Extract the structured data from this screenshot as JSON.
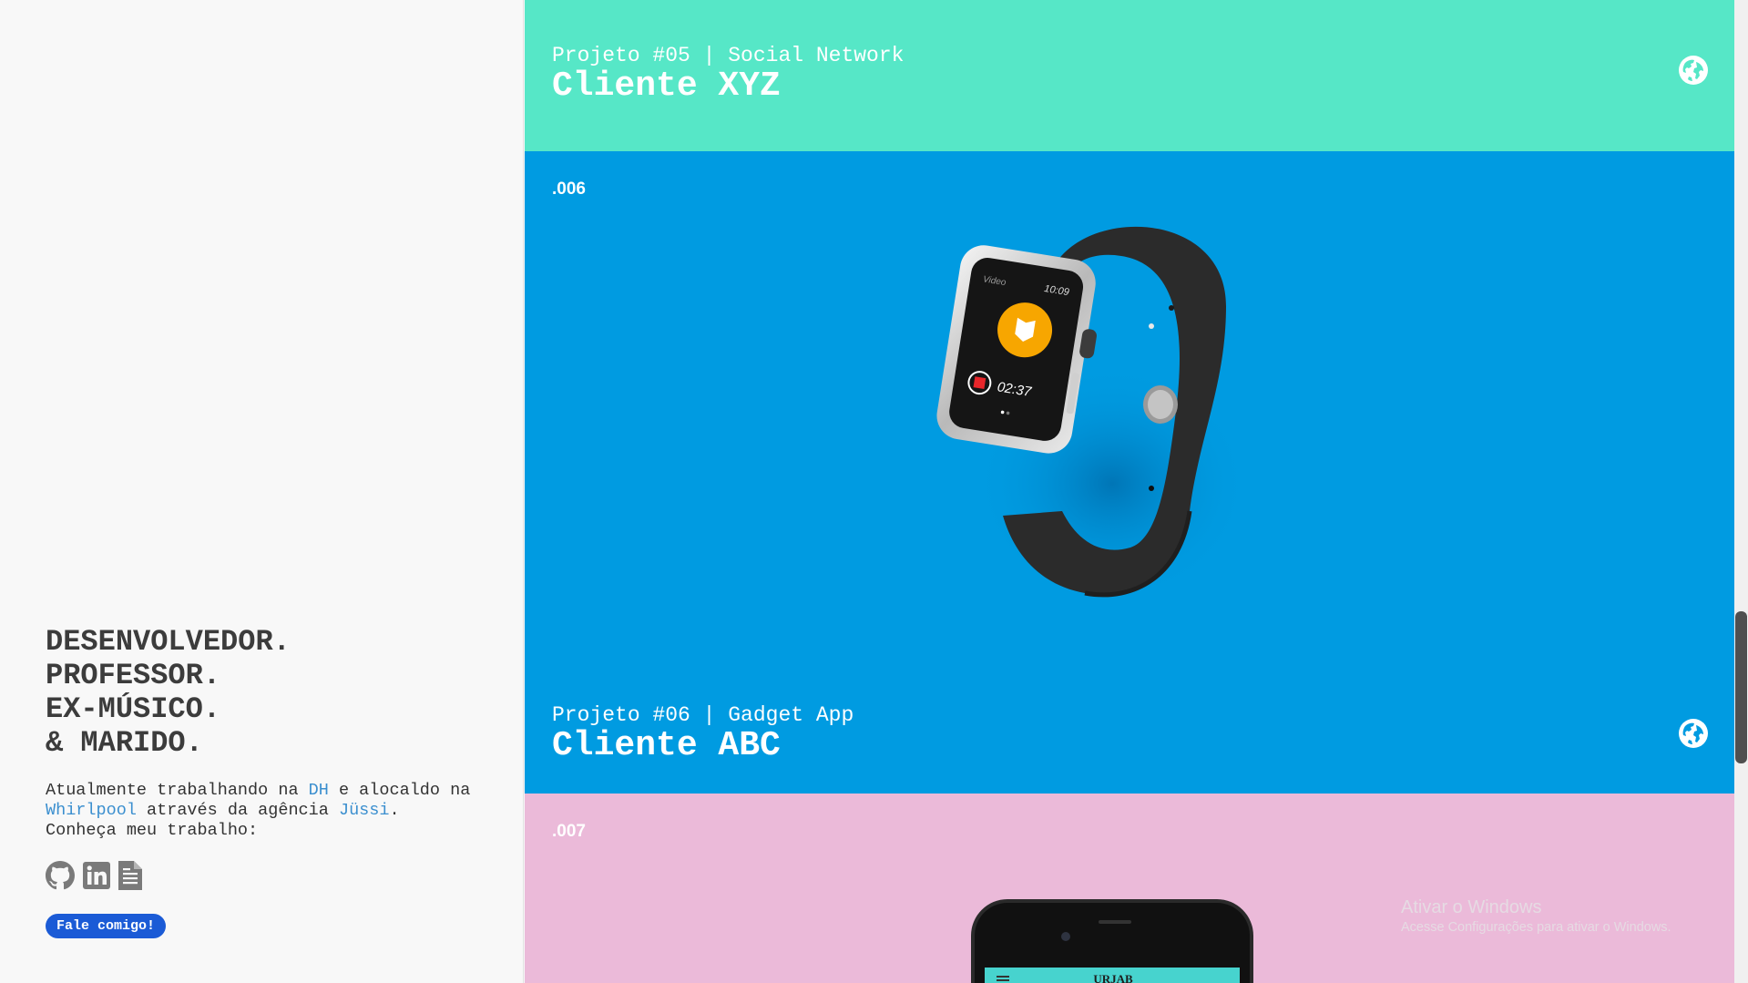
{
  "sidebar": {
    "tagline": [
      "DESENVOLVEDOR.",
      "PROFESSOR.",
      "EX-MÚSICO.",
      "& MARIDO."
    ],
    "bio": {
      "t1": "Atualmente trabalhando na ",
      "link_dh": "DH",
      "t2": " e alocaldo na ",
      "link_whirlpool": "Whirlpool",
      "t3": " através da agência ",
      "link_jussi": "Jüssi",
      "t4": ". Conheça meu trabalho:"
    },
    "social_icons": [
      "github-icon",
      "linkedin-icon",
      "resume-document-icon"
    ],
    "contact_button": "Fale comigo!"
  },
  "projects": [
    {
      "subtitle": "Projeto #05 | Social Network",
      "title": "Cliente XYZ",
      "color": "#56e7c7"
    },
    {
      "number": ".006",
      "subtitle": "Projeto #06 | Gadget App",
      "title": "Cliente ABC",
      "color": "#009be1",
      "watch_screen": {
        "label": "Video",
        "time": "10:09",
        "timer": "02:37"
      }
    },
    {
      "number": ".007",
      "color": "#ebbad9",
      "phone_screen": {
        "app_name": "URJAB"
      }
    }
  ],
  "windows_watermark": {
    "line1": "Ativar o Windows",
    "line2": "Acesse Configurações para ativar o Windows."
  },
  "icons": {
    "globe": "globe-icon"
  },
  "colors": {
    "accent": "#1b5bd6",
    "link": "#3b8fcf"
  }
}
